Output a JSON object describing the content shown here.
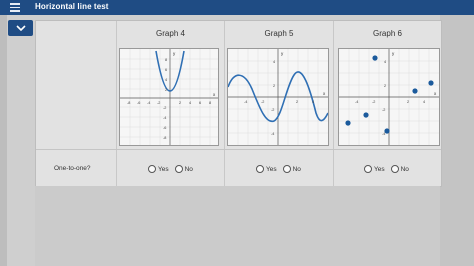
{
  "header": {
    "title": "Horizontal line test",
    "menu_icon": "hamburger-icon"
  },
  "collapse_button": {
    "icon": "chevron-down-icon"
  },
  "graphs": [
    {
      "title": "Graph 4"
    },
    {
      "title": "Graph 5"
    },
    {
      "title": "Graph 6"
    }
  ],
  "question": {
    "label": "One-to-one?",
    "yes_label": "Yes",
    "no_label": "No"
  },
  "axis": {
    "x_label": "x",
    "y_label": "y"
  },
  "graph4_ticks_x": [
    "-8",
    "-6",
    "-4",
    "-2",
    "2",
    "4",
    "6",
    "8"
  ],
  "graph4_ticks_y": [
    "8",
    "6",
    "4",
    "2",
    "-2",
    "-4",
    "-6",
    "-8"
  ],
  "graph5_ticks_x": [
    "-4",
    "-2",
    "2",
    "4"
  ],
  "graph5_ticks_y": [
    "4",
    "2",
    "-2",
    "-4"
  ],
  "graph6_ticks_x": [
    "-4",
    "-2",
    "2",
    "4"
  ],
  "graph6_ticks_y": [
    "4",
    "2",
    "-2",
    "-4"
  ]
}
